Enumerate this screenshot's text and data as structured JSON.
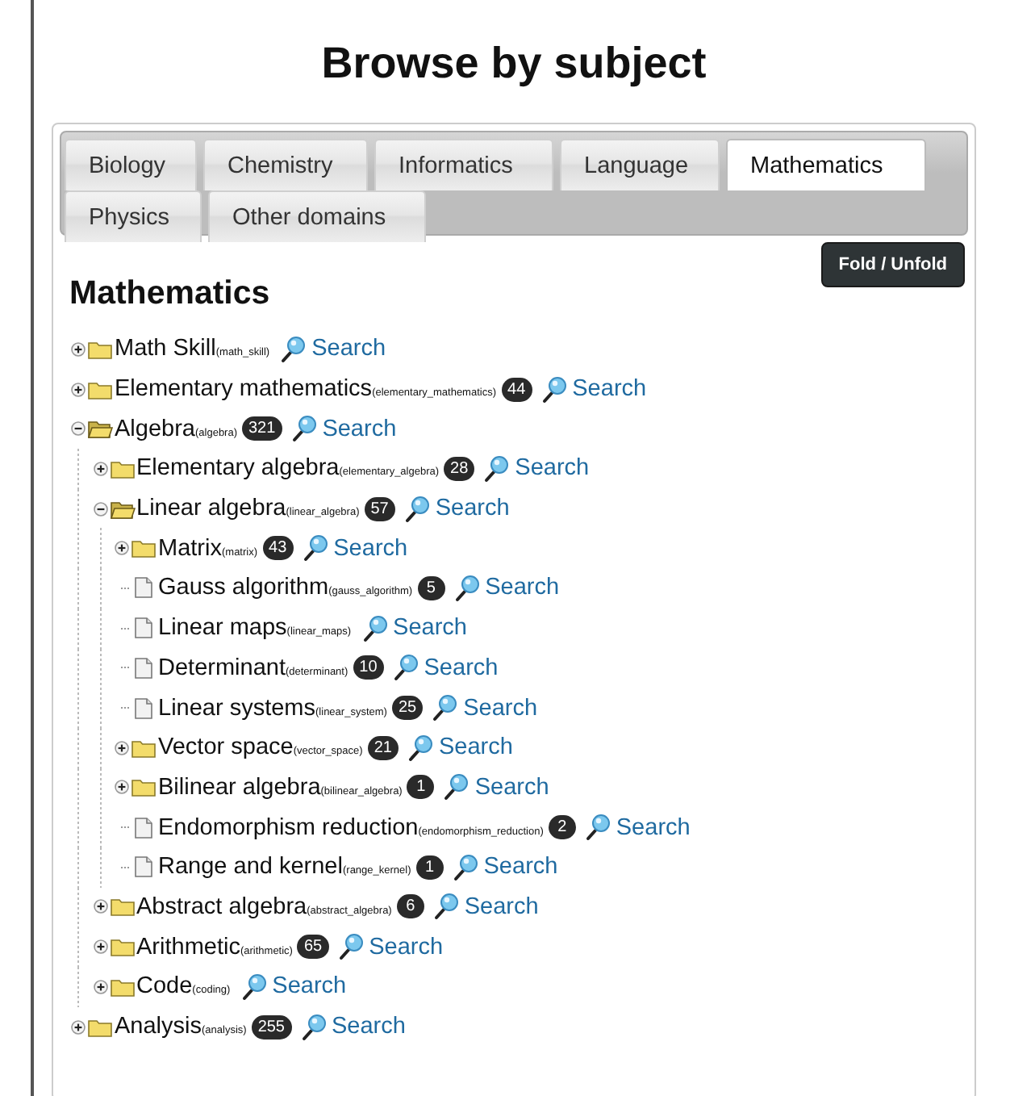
{
  "title": "Browse by subject",
  "tabs": [
    {
      "label": "Biology",
      "selected": false
    },
    {
      "label": "Chemistry",
      "selected": false
    },
    {
      "label": "Informatics",
      "selected": false
    },
    {
      "label": "Language",
      "selected": false
    },
    {
      "label": "Mathematics",
      "selected": true
    },
    {
      "label": "Physics",
      "selected": false
    },
    {
      "label": "Other domains",
      "selected": false
    }
  ],
  "fold_button": "Fold / Unfold",
  "heading": "Mathematics",
  "tree": [
    {
      "kind": "folder",
      "label": "Math Skill",
      "code": "(math_skill)",
      "expanded": false,
      "search": "Search"
    },
    {
      "kind": "folder",
      "label": "Elementary mathematics",
      "code": "(elementary_mathematics)",
      "count": "44",
      "expanded": false,
      "search": "Search"
    },
    {
      "kind": "folder",
      "label": "Algebra",
      "code": "(algebra)",
      "count": "321",
      "expanded": true,
      "search": "Search",
      "children": [
        {
          "kind": "folder",
          "label": "Elementary algebra",
          "code": "(elementary_algebra)",
          "count": "28",
          "expanded": false,
          "search": "Search"
        },
        {
          "kind": "folder",
          "label": "Linear algebra",
          "code": "(linear_algebra)",
          "count": "57",
          "expanded": true,
          "search": "Search",
          "children": [
            {
              "kind": "folder",
              "label": "Matrix",
              "code": "(matrix)",
              "count": "43",
              "expanded": false,
              "search": "Search"
            },
            {
              "kind": "leaf",
              "label": "Gauss algorithm",
              "code": "(gauss_algorithm)",
              "count": "5",
              "search": "Search"
            },
            {
              "kind": "leaf",
              "label": "Linear maps",
              "code": "(linear_maps)",
              "search": "Search"
            },
            {
              "kind": "leaf",
              "label": "Determinant",
              "code": "(determinant)",
              "count": "10",
              "search": "Search"
            },
            {
              "kind": "leaf",
              "label": "Linear systems",
              "code": "(linear_system)",
              "count": "25",
              "search": "Search"
            },
            {
              "kind": "folder",
              "label": "Vector space",
              "code": "(vector_space)",
              "count": "21",
              "expanded": false,
              "search": "Search"
            },
            {
              "kind": "folder",
              "label": "Bilinear algebra",
              "code": "(bilinear_algebra)",
              "count": "1",
              "expanded": false,
              "search": "Search"
            },
            {
              "kind": "leaf",
              "label": "Endomorphism reduction",
              "code": "(endomorphism_reduction)",
              "count": "2",
              "search": "Search"
            },
            {
              "kind": "leaf",
              "label": "Range and kernel",
              "code": "(range_kernel)",
              "count": "1",
              "search": "Search"
            }
          ]
        },
        {
          "kind": "folder",
          "label": "Abstract algebra",
          "code": "(abstract_algebra)",
          "count": "6",
          "expanded": false,
          "search": "Search"
        },
        {
          "kind": "folder",
          "label": "Arithmetic",
          "code": "(arithmetic)",
          "count": "65",
          "expanded": false,
          "search": "Search"
        },
        {
          "kind": "folder",
          "label": "Code",
          "code": "(coding)",
          "expanded": false,
          "search": "Search"
        }
      ]
    },
    {
      "kind": "folder",
      "label": "Analysis",
      "code": "(analysis)",
      "count": "255",
      "expanded": false,
      "search": "Search"
    }
  ]
}
